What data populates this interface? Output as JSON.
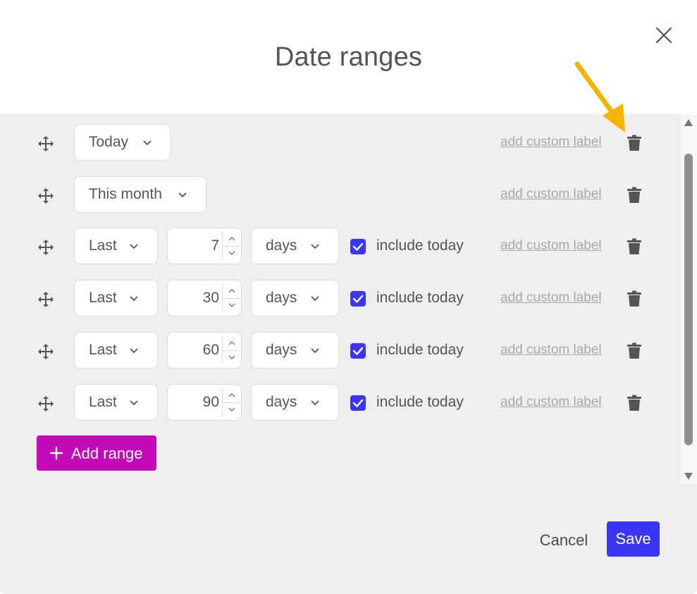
{
  "dialog": {
    "title": "Date ranges",
    "close_icon": "close-icon"
  },
  "rows": [
    {
      "period": "Today",
      "custom_label": "add custom label"
    },
    {
      "period": "This month",
      "custom_label": "add custom label"
    },
    {
      "period": "Last",
      "count": "7",
      "unit": "days",
      "include_today": true,
      "include_label": "include today",
      "custom_label": "add custom label"
    },
    {
      "period": "Last",
      "count": "30",
      "unit": "days",
      "include_today": true,
      "include_label": "include today",
      "custom_label": "add custom label"
    },
    {
      "period": "Last",
      "count": "60",
      "unit": "days",
      "include_today": true,
      "include_label": "include today",
      "custom_label": "add custom label"
    },
    {
      "period": "Last",
      "count": "90",
      "unit": "days",
      "include_today": true,
      "include_label": "include today",
      "custom_label": "add custom label"
    }
  ],
  "add_button": {
    "label": "Add range",
    "color": "#c20bb6"
  },
  "footer": {
    "cancel_label": "Cancel",
    "save_label": "Save",
    "save_color": "#3d35f5"
  },
  "annotation": {
    "color": "#f5b400",
    "points_to": "trash-icon"
  },
  "icons": {
    "drag": "move-icon",
    "dropdown": "chevron-down-icon",
    "delete": "trash-icon",
    "check": "checkmark-icon",
    "add": "plus-icon"
  }
}
